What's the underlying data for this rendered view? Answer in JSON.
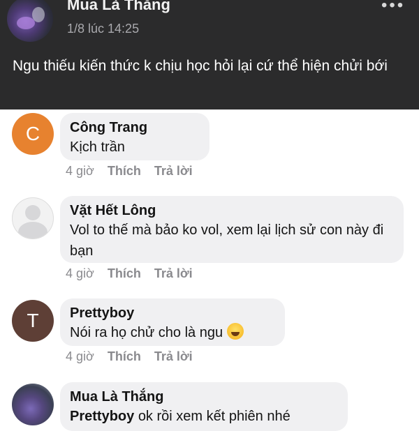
{
  "post": {
    "author": "Mua Là Thắng",
    "time": "1/8 lúc 14:25",
    "more_label": "•••",
    "text": "Ngu thiếu kiến thức k chịu học hỏi lại cứ thể hiện chửi bới"
  },
  "comments": [
    {
      "avatar_letter": "C",
      "name": "Công Trang",
      "text": "Kịch trần",
      "time": "4 giờ",
      "like": "Thích",
      "reply": "Trả lời"
    },
    {
      "name": "Vặt Hết Lông",
      "text": "Vol to thế mà bảo ko vol, xem lại lịch sử con này đi bạn",
      "time": "4 giờ",
      "like": "Thích",
      "reply": "Trả lời"
    },
    {
      "avatar_letter": "T",
      "name": "Prettyboy",
      "text": "Nói ra họ chử cho là ngu",
      "emoji": "rolling-on-floor-laughing-emoji",
      "time": "4 giờ",
      "like": "Thích",
      "reply": "Trả lời"
    },
    {
      "name": "Mua Là Thắng",
      "mention": "Prettyboy",
      "text": "ok rồi xem kết phiên nhé"
    }
  ],
  "colors": {
    "header_bg": "#2b2b2c",
    "bubble_bg": "#f0f0f2",
    "avatar_c": "#e7822f",
    "avatar_t": "#5e3f36",
    "meta_gray": "#8a8a8e"
  }
}
